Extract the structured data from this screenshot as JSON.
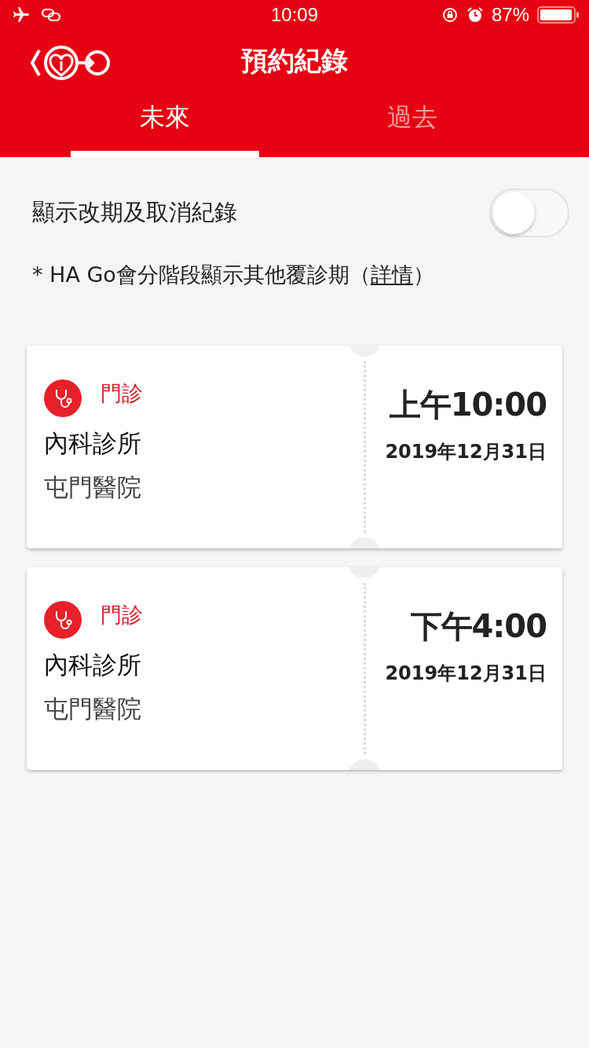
{
  "status_bar": {
    "time": "10:09",
    "battery": "87%"
  },
  "header": {
    "title": "預約紀錄"
  },
  "tabs": [
    {
      "label": "未來",
      "selected": true
    },
    {
      "label": "過去",
      "selected": false
    }
  ],
  "toggle": {
    "label": "顯示改期及取消紀錄",
    "on": false
  },
  "note": {
    "before": "* HA Go會分階段顯示其他覆診期（",
    "link": "詳情",
    "after": "）"
  },
  "appointments": [
    {
      "type": "門診",
      "clinic": "內科診所",
      "hospital": "屯門醫院",
      "time": "上午10:00",
      "date": "2019年12月31日"
    },
    {
      "type": "門診",
      "clinic": "內科診所",
      "hospital": "屯門醫院",
      "time": "下午4:00",
      "date": "2019年12月31日"
    }
  ]
}
